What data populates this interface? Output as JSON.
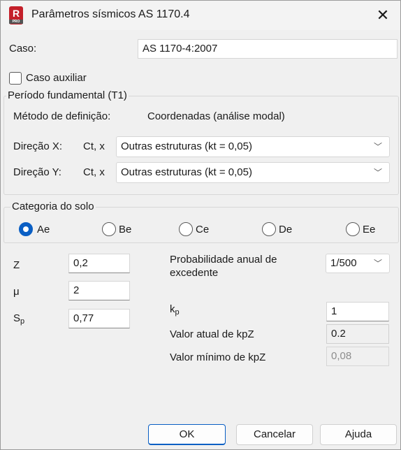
{
  "window": {
    "title": "Parâmetros sísmicos AS 1170.4",
    "icon_label": "R",
    "icon_badge": "PRO"
  },
  "caso": {
    "label": "Caso:",
    "value": "AS 1170-4:2007"
  },
  "caso_auxiliar": {
    "label": "Caso auxiliar",
    "checked": false
  },
  "periodo": {
    "legend": "Período fundamental (T1)",
    "metodo_label": "Método de definição:",
    "metodo_value": "Coordenadas (análise modal)",
    "dir_x": {
      "label": "Direção X:",
      "ct": "Ct, x",
      "value": "Outras estruturas (kt = 0,05)"
    },
    "dir_y": {
      "label": "Direção Y:",
      "ct": "Ct, x",
      "value": "Outras estruturas (kt = 0,05)"
    }
  },
  "solo": {
    "legend": "Categoria do solo",
    "options": [
      "Ae",
      "Be",
      "Ce",
      "De",
      "Ee"
    ],
    "selected": "Ae"
  },
  "params": {
    "z_label": "Z",
    "z_value": "0,2",
    "mu_label": "μ",
    "mu_value": "2",
    "sp_label_main": "S",
    "sp_label_sub": "p",
    "sp_value": "0,77"
  },
  "prob": {
    "label": "Probabilidade anual de excedente",
    "value": "1/500"
  },
  "kp": {
    "label_main": "k",
    "label_sub": "p",
    "value": "1"
  },
  "kpz_atual": {
    "label": "Valor atual de kpZ",
    "value": "0.2"
  },
  "kpz_min": {
    "label": "Valor mínimo de kpZ",
    "value": "0,08"
  },
  "buttons": {
    "ok": "OK",
    "cancel": "Cancelar",
    "help": "Ajuda"
  },
  "icons": {
    "close": "close-icon",
    "chevron": "chevron-down-icon"
  }
}
